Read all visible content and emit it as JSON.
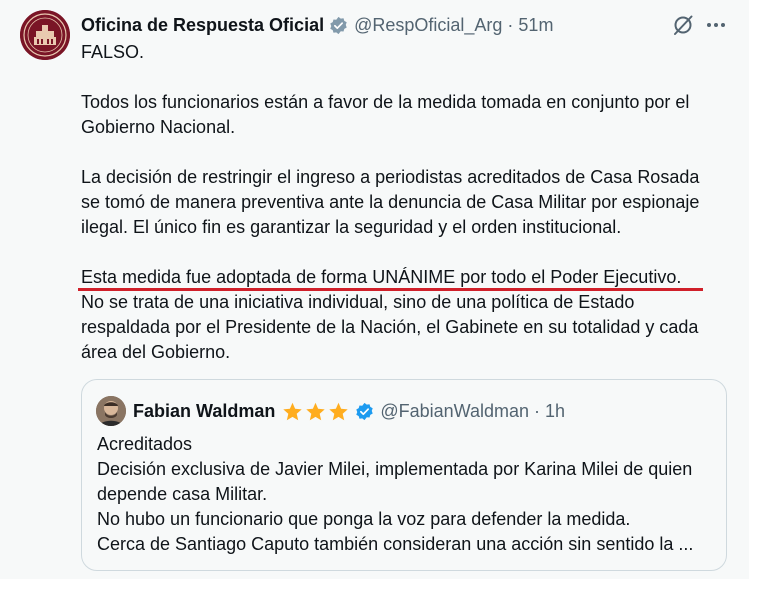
{
  "tweet": {
    "author_name": "Oficina de Respuesta Oficial",
    "author_handle": "@RespOficial_Arg",
    "separator": "·",
    "time": "51m",
    "verified_icon": "verified-badge-gray",
    "lines_p1": [
      "FALSO."
    ],
    "lines_p2": [
      "Todos los funcionarios están a favor de la medida tomada en conjunto por el",
      "Gobierno Nacional."
    ],
    "lines_p3": [
      "La decisión de restringir el ingreso a periodistas acreditados de Casa Rosada",
      "se tomó de manera preventiva ante la denuncia de Casa Militar por espionaje",
      "ilegal. El único fin es garantizar la seguridad y el orden institucional."
    ],
    "lines_p4": [
      "Esta medida fue adoptada de forma UNÁNIME por todo el Poder Ejecutivo.",
      "No se trata de una iniciativa individual, sino de una política de Estado",
      "respaldada por el Presidente de la Nación, el Gabinete en su totalidad y cada",
      "área del Gobierno."
    ]
  },
  "quoted": {
    "author_name": "Fabian Waldman",
    "author_handle": "@FabianWaldman",
    "separator": "·",
    "time": "1h",
    "verified_icon": "verified-badge-blue",
    "lines": [
      "Acreditados",
      "Decisión exclusiva de Javier Milei, implementada por Karina Milei de quien",
      "depende casa Militar.",
      "No hubo un funcionario que ponga la voz para defender la medida.",
      "Cerca de Santiago Caputo también consideran una acción sin sentido la ..."
    ]
  },
  "colors": {
    "background": "#f7f9f9",
    "text": "#0f1419",
    "secondary": "#536471",
    "verified_blue": "#1d9bf0",
    "verified_gray": "#829aab",
    "star": "#ffad1f",
    "highlight_underline": "#d0202a",
    "avatar_brand": "#7a1526"
  }
}
